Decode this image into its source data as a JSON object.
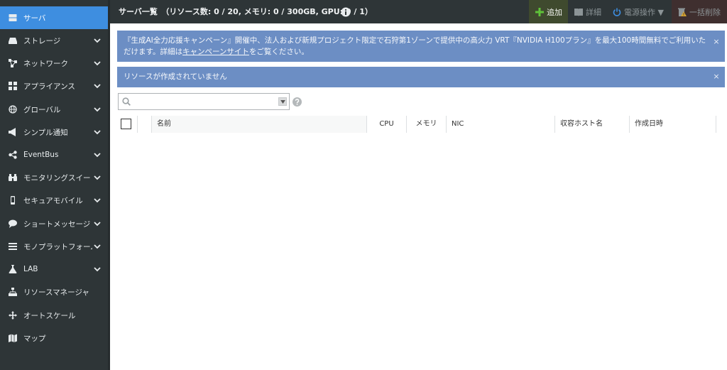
{
  "sidebar": {
    "items": [
      {
        "label": "サーバ",
        "icon": "server-icon",
        "active": true,
        "chevron": false
      },
      {
        "label": "ストレージ",
        "icon": "storage-icon",
        "chevron": true
      },
      {
        "label": "ネットワーク",
        "icon": "network-icon",
        "chevron": true
      },
      {
        "label": "アプライアンス",
        "icon": "appliance-icon",
        "chevron": true
      },
      {
        "label": "グローバル",
        "icon": "globe-icon",
        "chevron": true
      },
      {
        "label": "シンプル通知",
        "icon": "megaphone-icon",
        "chevron": true
      },
      {
        "label": "EventBus",
        "icon": "share-icon",
        "chevron": true
      },
      {
        "label": "モニタリングスイート",
        "icon": "binoculars-icon",
        "chevron": true
      },
      {
        "label": "セキュアモバイル",
        "icon": "mobile-icon",
        "chevron": true
      },
      {
        "label": "ショートメッセージ",
        "icon": "chat-bubble-icon",
        "chevron": true
      },
      {
        "label": "モノプラットフォーム",
        "icon": "list-icon",
        "chevron": true
      },
      {
        "label": "LAB",
        "icon": "flask-icon",
        "chevron": true
      },
      {
        "label": "リソースマネージャ",
        "icon": "sitemap-icon",
        "chevron": false
      },
      {
        "label": "オートスケール",
        "icon": "move-arrows-icon",
        "chevron": false
      },
      {
        "label": "マップ",
        "icon": "map-icon",
        "chevron": false
      }
    ]
  },
  "header": {
    "title": "サーバ一覧　（リソース数: 0 / 20, メモリ: 0 / 300GB, GPU: 0 / 1）",
    "toolbar": {
      "add_label": "追加",
      "detail_label": "詳細",
      "power_label": "電源操作 ▼",
      "delete_label": "一括削除"
    }
  },
  "alerts": {
    "campaign": {
      "text_before": "『生成AI全力応援キャンペーン』開催中、法人および新規プロジェクト限定で石狩第1ゾーンで提供中の高火力 VRT『NVIDIA H100プラン』を最大100時間無料でご利用いただけます。詳細は",
      "link_text": "キャンペーンサイト",
      "text_after": "をご覧ください。"
    },
    "empty": {
      "text": "リソースが作成されていません"
    },
    "close_glyph": "×"
  },
  "search": {
    "value": "",
    "placeholder": ""
  },
  "table": {
    "columns": [
      "名前",
      "CPU",
      "メモリ",
      "NIC",
      "収容ホスト名",
      "作成日時"
    ]
  },
  "colors": {
    "sidebar_bg": "#2e3537",
    "active_item": "#3e8ee0",
    "alert_bg": "#6c8ec4",
    "add_button_bg": "#3f4a2e",
    "add_icon": "#5fc23a",
    "delete_button_bg": "#3f2f2f",
    "delete_icon": "#d7a531"
  }
}
